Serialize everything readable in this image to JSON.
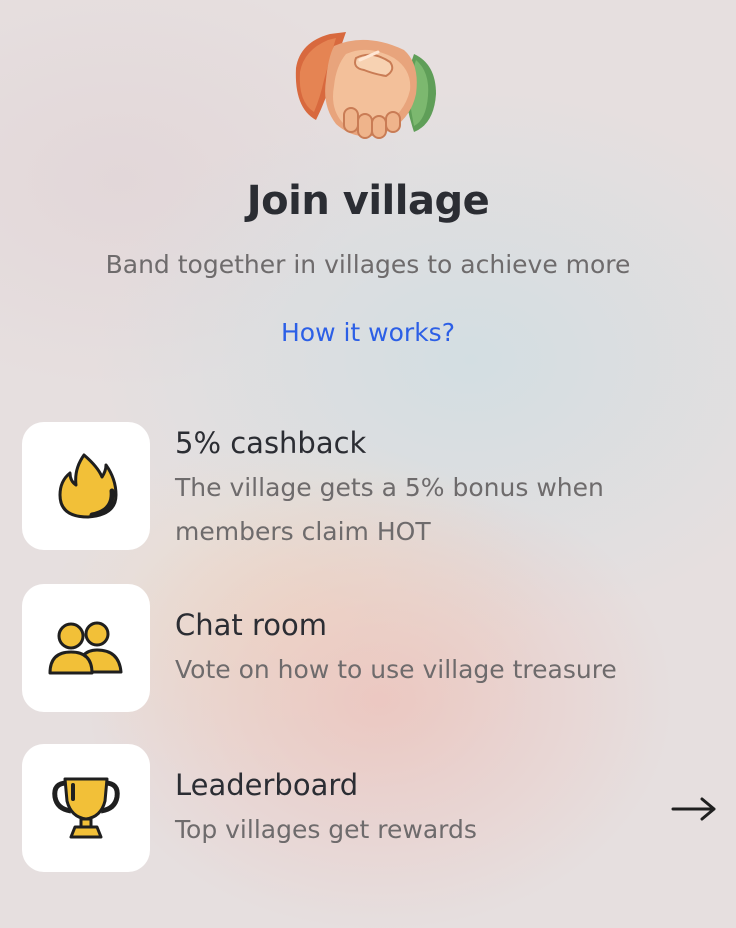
{
  "header": {
    "icon": "handshake-icon",
    "title": "Join village",
    "subtitle": "Band together in villages to achieve more",
    "how_link": "How it works?"
  },
  "features": [
    {
      "icon": "flame-icon",
      "title": "5% cashback",
      "description": "The village gets a 5% bonus when members claim HOT"
    },
    {
      "icon": "users-icon",
      "title": "Chat room",
      "description": "Vote on how to use village treasure"
    },
    {
      "icon": "trophy-icon",
      "title": "Leaderboard",
      "description": "Top villages get rewards"
    }
  ],
  "colors": {
    "accent_link": "#2c5fe6",
    "icon_yellow": "#f2c038",
    "text_dark": "#2b2d33",
    "text_muted": "#6e6b6c"
  }
}
